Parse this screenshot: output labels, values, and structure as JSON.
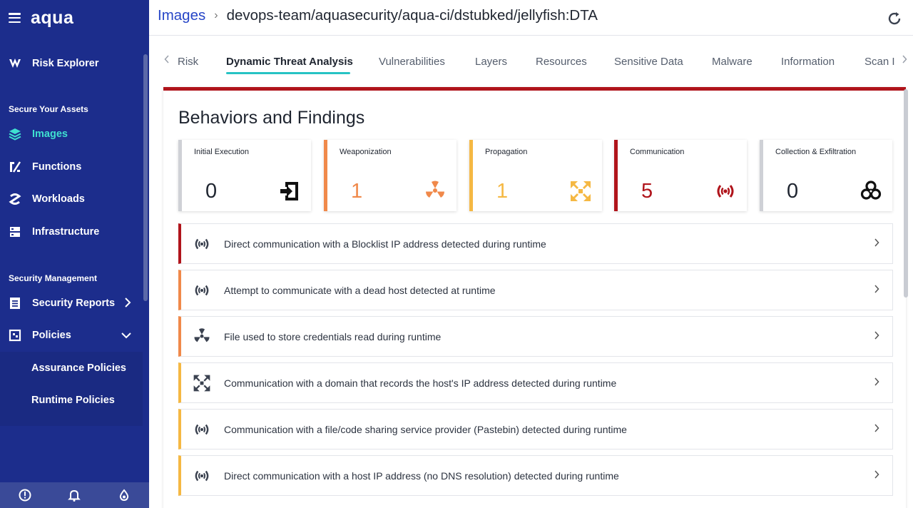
{
  "sidebar": {
    "logo": "aqua",
    "risk_explorer": "Risk Explorer",
    "section_assets": "Secure Your Assets",
    "images": "Images",
    "functions": "Functions",
    "workloads": "Workloads",
    "infrastructure": "Infrastructure",
    "section_security": "Security Management",
    "security_reports": "Security Reports",
    "policies": "Policies",
    "assurance_policies": "Assurance Policies",
    "runtime_policies": "Runtime Policies"
  },
  "header": {
    "breadcrumb_link": "Images",
    "breadcrumb_separator": "›",
    "breadcrumb_current": "devops-team/aquasecurity/aqua-ci/dstubked/jellyfish:DTA"
  },
  "tabs": [
    "Risk",
    "Dynamic Threat Analysis",
    "Vulnerabilities",
    "Layers",
    "Resources",
    "Sensitive Data",
    "Malware",
    "Information",
    "Scan I"
  ],
  "active_tab": "Dynamic Threat Analysis",
  "panel_title": "Behaviors and Findings",
  "cards": [
    {
      "label": "Initial Execution",
      "count": "0",
      "color": "#cfd1d6",
      "count_color": "#1f2530",
      "icon": "entry-icon"
    },
    {
      "label": "Weaponization",
      "count": "1",
      "color": "#f0894a",
      "count_color": "#f0894a",
      "icon": "radiation-icon"
    },
    {
      "label": "Propagation",
      "count": "1",
      "color": "#f5b843",
      "count_color": "#f5b843",
      "icon": "propagation-icon"
    },
    {
      "label": "Communication",
      "count": "5",
      "color": "#b0141b",
      "count_color": "#b0141b",
      "icon": "broadcast-icon"
    },
    {
      "label": "Collection & Exfiltration",
      "count": "0",
      "color": "#cfd1d6",
      "count_color": "#1f2530",
      "icon": "biohazard-icon"
    }
  ],
  "findings": [
    {
      "text": "Direct communication with a Blocklist IP address detected during runtime",
      "color": "#b0141b",
      "icon": "broadcast-icon"
    },
    {
      "text": "Attempt to communicate with a dead host detected at runtime",
      "color": "#f0894a",
      "icon": "broadcast-icon"
    },
    {
      "text": "File used to store credentials read during runtime",
      "color": "#f0894a",
      "icon": "radiation-icon"
    },
    {
      "text": "Communication with a domain that records the host's IP address detected during runtime",
      "color": "#f5b843",
      "icon": "propagation-icon"
    },
    {
      "text": "Communication with a file/code sharing service provider (Pastebin) detected during runtime",
      "color": "#f5b843",
      "icon": "broadcast-icon"
    },
    {
      "text": "Direct communication with a host IP address (no DNS resolution) detected during runtime",
      "color": "#f5b843",
      "icon": "broadcast-icon"
    }
  ],
  "colors": {
    "sidebar": "#1c2d8c",
    "accent": "#3fe0d0",
    "link": "#2746c7",
    "critical": "#b0141b"
  }
}
